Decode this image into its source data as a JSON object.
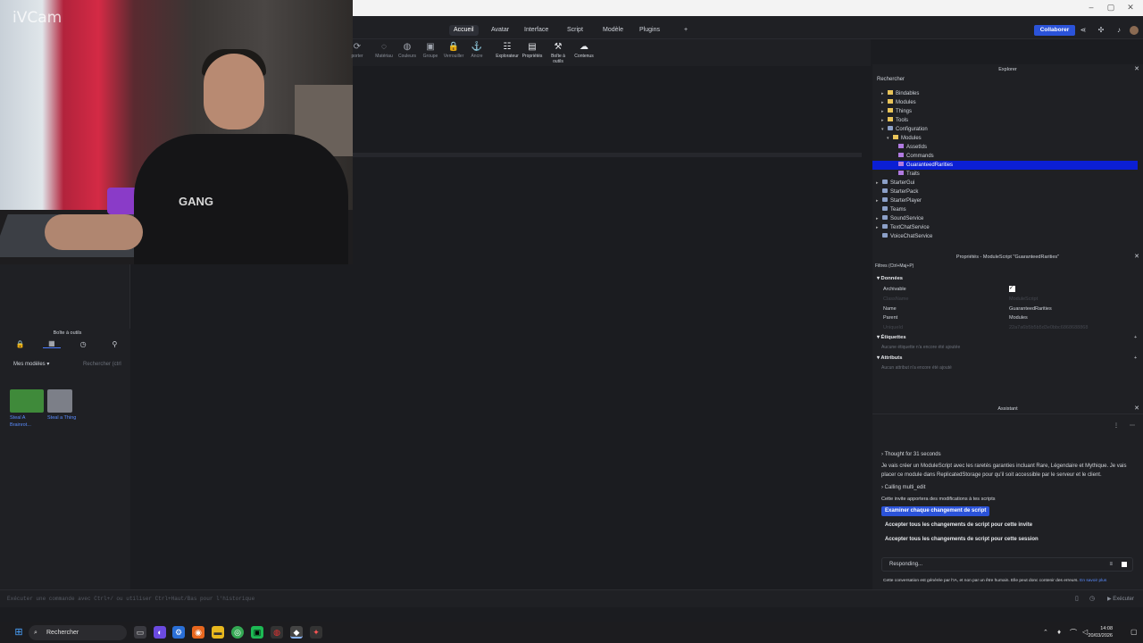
{
  "window": {
    "min": "–",
    "max": "▢",
    "close": "✕"
  },
  "menu": {
    "tabs": [
      "Accueil",
      "Avatar",
      "Interface",
      "Script",
      "Modèle",
      "Plugins"
    ],
    "active": "Accueil",
    "add": "+",
    "collaborate": "Collaborer"
  },
  "toolbar": {
    "partial_label": "porter",
    "tools": [
      {
        "label": "Matériau",
        "icon": "◌"
      },
      {
        "label": "Couleurs",
        "icon": "◍"
      },
      {
        "label": "Groupe",
        "icon": "▣"
      },
      {
        "label": "Verrouiller",
        "icon": "🔒"
      },
      {
        "label": "Ancre",
        "icon": "⚓"
      },
      {
        "label": "Explorateur",
        "icon": "☷"
      },
      {
        "label": "Propriétés",
        "icon": "▤"
      },
      {
        "label": "Boîte à outils",
        "icon": "⚒"
      },
      {
        "label": "Contenus",
        "icon": "☁"
      }
    ]
  },
  "webcam": {
    "watermark": "iVCam",
    "shirt_text": "GANG"
  },
  "toolbox": {
    "title": "Boîte à outils",
    "filter": "Mes modèles",
    "search_placeholder": "Rechercher (ctrl",
    "models": [
      {
        "name": "Steal A Brainrot...",
        "thumb_color": "#3f8a3a"
      },
      {
        "name": "Steal a Thing",
        "thumb_color": "#7c7f88"
      }
    ]
  },
  "explorer": {
    "title": "Explorer",
    "search": "Rechercher",
    "items": [
      {
        "label": "Bindables",
        "depth": 1,
        "icon": "folder",
        "caret": "▸"
      },
      {
        "label": "Modules",
        "depth": 1,
        "icon": "folder",
        "caret": "▸"
      },
      {
        "label": "Things",
        "depth": 1,
        "icon": "folder",
        "caret": "▸"
      },
      {
        "label": "Tools",
        "depth": 1,
        "icon": "folder",
        "caret": "▸"
      },
      {
        "label": "Configuration",
        "depth": 1,
        "icon": "gear",
        "caret": "▾"
      },
      {
        "label": "Modules",
        "depth": 2,
        "icon": "folder",
        "caret": "▾"
      },
      {
        "label": "AssetIds",
        "depth": 3,
        "icon": "module",
        "caret": ""
      },
      {
        "label": "Commands",
        "depth": 3,
        "icon": "module",
        "caret": ""
      },
      {
        "label": "GuaranteedRarities",
        "depth": 3,
        "icon": "module",
        "caret": "",
        "selected": true
      },
      {
        "label": "Traits",
        "depth": 3,
        "icon": "module",
        "caret": ""
      },
      {
        "label": "StarterGui",
        "depth": 0,
        "icon": "service",
        "caret": "▸"
      },
      {
        "label": "StarterPack",
        "depth": 0,
        "icon": "service",
        "caret": ""
      },
      {
        "label": "StarterPlayer",
        "depth": 0,
        "icon": "service",
        "caret": "▸"
      },
      {
        "label": "Teams",
        "depth": 0,
        "icon": "service",
        "caret": ""
      },
      {
        "label": "SoundService",
        "depth": 0,
        "icon": "service",
        "caret": "▸"
      },
      {
        "label": "TextChatService",
        "depth": 0,
        "icon": "service",
        "caret": "▸"
      },
      {
        "label": "VoiceChatService",
        "depth": 0,
        "icon": "service",
        "caret": ""
      }
    ]
  },
  "properties": {
    "title": "Propriétés - ModuleScript \"GuaranteedRarities\"",
    "filter": "Filtres (Ctrl+Maj+P)",
    "sections": {
      "data": "Données",
      "tags": "Étiquettes",
      "attributes": "Attributs"
    },
    "rows": [
      {
        "name": "Archivable",
        "value": "✓",
        "dim": false
      },
      {
        "name": "ClassName",
        "value": "ModuleScript",
        "dim": true
      },
      {
        "name": "Name",
        "value": "GuaranteedRarities",
        "dim": false
      },
      {
        "name": "Parent",
        "value": "Modules",
        "dim": false
      },
      {
        "name": "UniqueId",
        "value": "22a7a6b5b5b5d3e0bbc6868688868",
        "dim": true
      }
    ],
    "tags_hint": "Aucune étiquette n'a encore été ajoutée",
    "attributes_hint": "Aucun attribut n'a encore été ajouté"
  },
  "assistant": {
    "title": "Assistant",
    "thought": "Thought for 31 seconds",
    "message": "Je vais créer un ModuleScript avec les raretés garanties incluant Rare, Légendaire et Mythique. Je vais placer ce module dans ReplicatedStorage pour qu'il soit accessible par le serveur et le client.",
    "calling": "Calling multi_edit",
    "notice": "Cette invite apportera des modifications à tes scripts",
    "btn_review": "Examiner chaque changement de script",
    "btn_accept_prompt": "Accepter tous les changements de script pour cette invite",
    "btn_accept_session": "Accepter tous les changements de script pour cette session",
    "responding": "Responding...",
    "disclaimer": "Cette conversation est générée par l'IA, et non par un être humain. Elle peut donc contenir des erreurs.",
    "learn_more": "En savoir plus"
  },
  "commandbar": {
    "placeholder": "Exécuter une commande avec Ctrl+/ ou utiliser Ctrl+Haut/Bas pour l'historique",
    "run": "▶ Exécuter"
  },
  "taskbar": {
    "search": "Rechercher",
    "time": "14:08",
    "date": "20/03/2026"
  }
}
